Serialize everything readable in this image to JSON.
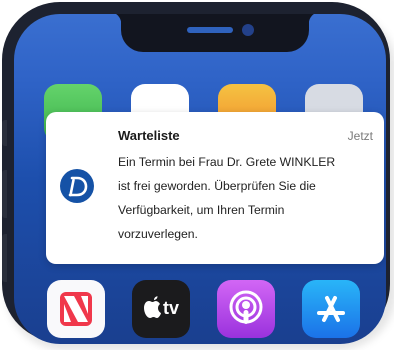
{
  "notification": {
    "title": "Warteliste",
    "time": "Jetzt",
    "message": "Ein Termin bei Frau Dr. Grete WINKLER\nist frei geworden. Überprüfen Sie die\nVerfügbarkeit, um Ihren Termin\nvorzuverlegen.",
    "app_icon": "doctolib-d-logo",
    "accent_color": "#1552a6"
  },
  "dock": {
    "apps": [
      {
        "icon": "news-icon"
      },
      {
        "icon": "apple-tv-icon",
        "label": "tv"
      },
      {
        "icon": "podcasts-icon"
      },
      {
        "icon": "app-store-icon"
      }
    ]
  }
}
